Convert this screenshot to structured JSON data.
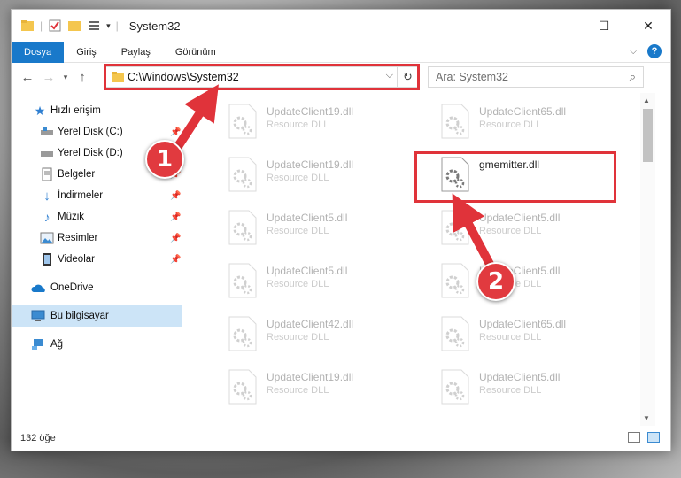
{
  "window": {
    "title": "System32"
  },
  "ribbon": {
    "tabs": [
      {
        "label": "Dosya"
      },
      {
        "label": "Giriş"
      },
      {
        "label": "Paylaş"
      },
      {
        "label": "Görünüm"
      }
    ]
  },
  "navigation": {
    "address_path": "C:\\Windows\\System32",
    "search_placeholder": "Ara: System32"
  },
  "sidebar": {
    "items": [
      {
        "label": "Hızlı erişim",
        "icon": "star-icon"
      },
      {
        "label": "Yerel Disk (C:)",
        "icon": "drive-icon"
      },
      {
        "label": "Yerel Disk (D:)",
        "icon": "drive-icon"
      },
      {
        "label": "Belgeler",
        "icon": "documents-icon"
      },
      {
        "label": "İndirmeler",
        "icon": "download-icon"
      },
      {
        "label": "Müzik",
        "icon": "music-icon"
      },
      {
        "label": "Resimler",
        "icon": "pictures-icon"
      },
      {
        "label": "Videolar",
        "icon": "videos-icon"
      },
      {
        "label": "OneDrive",
        "icon": "cloud-icon"
      },
      {
        "label": "Bu bilgisayar",
        "icon": "computer-icon"
      },
      {
        "label": "Ağ",
        "icon": "network-icon"
      }
    ]
  },
  "files": [
    {
      "name": "UpdateClient19.dll",
      "type": "Resource DLL"
    },
    {
      "name": "UpdateClient65.dll",
      "type": "Resource DLL"
    },
    {
      "name": "UpdateClient19.dll",
      "type": "Resource DLL"
    },
    {
      "name": "gmemitter.dll",
      "type": ""
    },
    {
      "name": "UpdateClient5.dll",
      "type": "Resource DLL"
    },
    {
      "name": "UpdateClient5.dll",
      "type": "Resource DLL"
    },
    {
      "name": "UpdateClient5.dll",
      "type": "Resource DLL"
    },
    {
      "name": "UpdateClient5.dll",
      "type": "Resource DLL"
    },
    {
      "name": "UpdateClient42.dll",
      "type": "Resource DLL"
    },
    {
      "name": "UpdateClient65.dll",
      "type": "Resource DLL"
    },
    {
      "name": "UpdateClient19.dll",
      "type": "Resource DLL"
    },
    {
      "name": "UpdateClient5.dll",
      "type": "Resource DLL"
    }
  ],
  "status": {
    "item_count": "132 öğe"
  },
  "annotations": {
    "step1": "1",
    "step2": "2",
    "color": "#e0333a"
  }
}
